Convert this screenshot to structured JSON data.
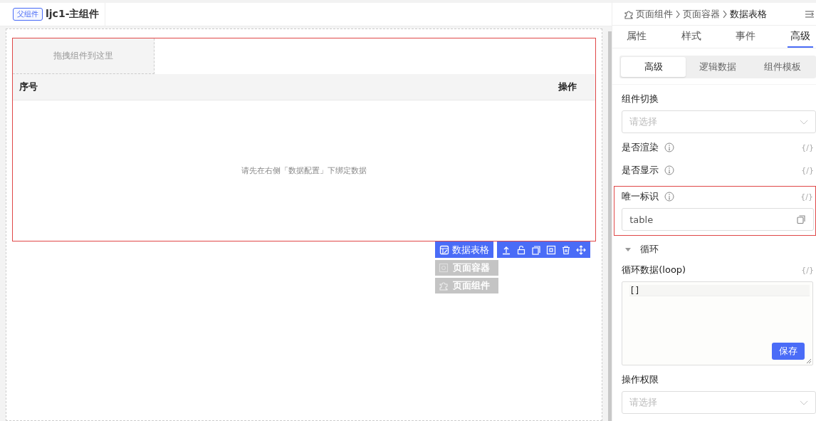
{
  "top_bar": {
    "parent_button": "父组件",
    "title": "ljc1-主组件"
  },
  "canvas": {
    "drop_zone": "拖拽组件到这里",
    "table": {
      "columns": [
        "序号",
        "操作"
      ],
      "empty_text": "请先在右侧「数据配置」下绑定数据"
    },
    "toolbar": {
      "label": "数据表格"
    },
    "ancestors": [
      {
        "label": "页面容器",
        "kind": "container"
      },
      {
        "label": "页面组件",
        "kind": "component"
      }
    ]
  },
  "panel": {
    "breadcrumb": [
      "页面组件",
      "页面容器",
      "数据表格"
    ],
    "tabs": [
      {
        "label": "属性",
        "selected": false
      },
      {
        "label": "样式",
        "selected": false
      },
      {
        "label": "事件",
        "selected": false
      },
      {
        "label": "高级",
        "selected": true
      }
    ],
    "subtabs": [
      {
        "label": "高级",
        "selected": true
      },
      {
        "label": "逻辑数据",
        "selected": false
      },
      {
        "label": "组件模板",
        "selected": false
      }
    ],
    "fields": [
      {
        "kind": "select",
        "label": "组件切换",
        "placeholder": "请选择"
      },
      {
        "kind": "label",
        "label": "是否渲染",
        "info": true,
        "expr": "{/}"
      },
      {
        "kind": "label",
        "label": "是否显示",
        "info": true,
        "expr": "{/}"
      },
      {
        "kind": "input",
        "label": "唯一标识",
        "info": true,
        "expr": "{/}",
        "value": "table",
        "highlighted": true
      },
      {
        "kind": "section",
        "label": "循环",
        "expanded": true
      },
      {
        "kind": "textarea",
        "label": "循环数据(loop)",
        "expr": "{/}",
        "value": "[]",
        "button": "保存"
      },
      {
        "kind": "select",
        "label": "操作权限",
        "placeholder": "请选择"
      }
    ]
  }
}
